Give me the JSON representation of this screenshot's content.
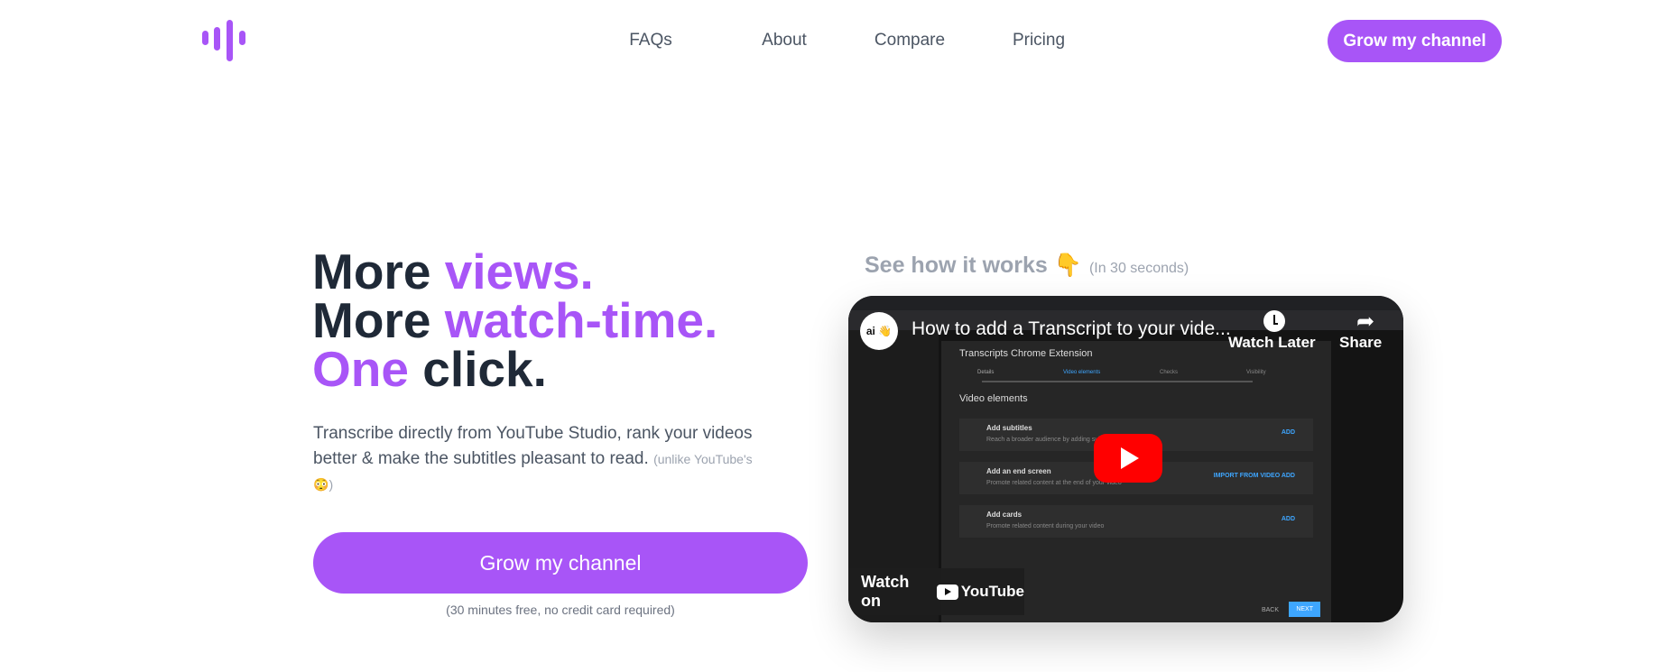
{
  "nav": {
    "items": [
      {
        "label": "FAQs"
      },
      {
        "label": "About"
      },
      {
        "label": "Compare"
      },
      {
        "label": "Pricing"
      }
    ],
    "cta": "Grow my channel"
  },
  "hero": {
    "line1": {
      "a": "More ",
      "b": "views."
    },
    "line2": {
      "a": "More ",
      "b": "watch-time."
    },
    "line3": {
      "a": "One",
      "b": " click."
    },
    "subtitle": "Transcribe directly from YouTube Studio, rank your videos better & make the subtitles pleasant to read.",
    "aside": "(unlike YouTube's",
    "aside_emoji": "😳",
    "aside_close": ")",
    "cta": "Grow my channel",
    "note": "(30 minutes free, no credit card required)"
  },
  "video_section": {
    "heading": "See how it works",
    "heading_emoji": "👇",
    "duration_note": "(In 30 seconds)",
    "video": {
      "channel_badge": "ai 👋",
      "title": "How to add a Transcript to your vide...",
      "watch_later": "Watch Later",
      "share": "Share",
      "watch_on": "Watch on",
      "youtube": "YouTube",
      "thumbnail": {
        "dialog_title": "Transcripts Chrome Extension",
        "steps": [
          "Details",
          "Video elements",
          "Checks",
          "Visibility"
        ],
        "section": "Video elements",
        "rows": [
          {
            "title": "Add subtitles",
            "desc": "Reach a broader audience by adding subtitles",
            "action": "ADD"
          },
          {
            "title": "Add an end screen",
            "desc": "Promote related content at the end of your video",
            "action": "IMPORT FROM VIDEO   ADD"
          },
          {
            "title": "Add cards",
            "desc": "Promote related content during your video",
            "action": "ADD"
          }
        ],
        "back": "BACK",
        "next": "NEXT"
      }
    }
  },
  "colors": {
    "accent": "#a855f7",
    "heading": "#1f2937",
    "youtube_red": "#ff0000"
  }
}
